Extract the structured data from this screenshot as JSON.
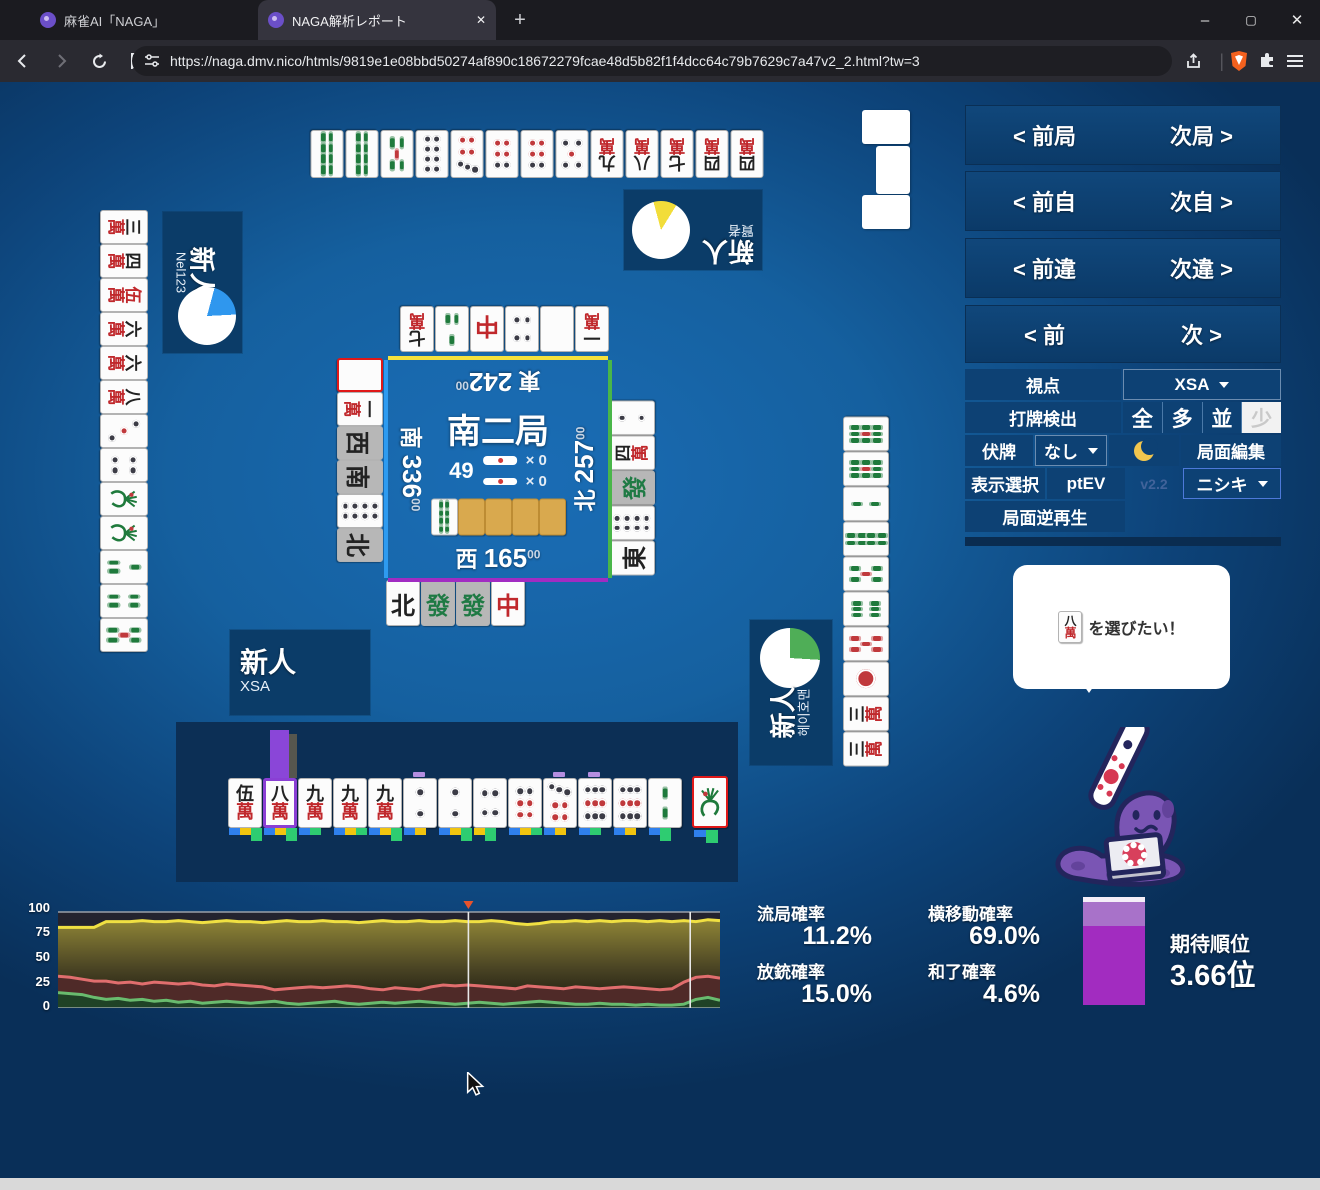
{
  "browser": {
    "tab1": "麻雀AI「NAGA」",
    "tab2": "NAGA解析レポート",
    "new_tab": "+",
    "close_tab": "✕",
    "minimize": "–",
    "maximize": "▢",
    "close_window": "✕",
    "url": "https://naga.dmv.nico/htmls/9819e1e08bbd50274af890c18672279fcae48d5b82f1f4dcc64c79b7629c7a47v2_2.html?tw=3"
  },
  "nav": {
    "rows": [
      {
        "prev": "< 前局",
        "next": "次局 >"
      },
      {
        "prev": "< 前自",
        "next": "次自 >"
      },
      {
        "prev": "< 前違",
        "next": "次違 >"
      },
      {
        "prev": "< 前",
        "next": "次 >"
      }
    ]
  },
  "controls": {
    "viewpoint_label": "視点",
    "viewpoint_value": "XSA",
    "dahai_label": "打牌検出",
    "dahai_options": [
      "全",
      "多",
      "並",
      "少"
    ],
    "dahai_selected": "少",
    "fusehai_label": "伏牌",
    "fusehai_value": "なし",
    "kyokumen_edit": "局面編集",
    "display_label": "表示選択",
    "display_value": "ptEV",
    "version": "v2.2",
    "model_value": "ニシキ",
    "replay": "局面逆再生"
  },
  "players": {
    "top": {
      "rank": "新人",
      "name": "賢者",
      "pie_color": "#f2dd3a",
      "pie_pct": 13
    },
    "left": {
      "rank": "新人",
      "name": "Nel123",
      "pie_color": "#2f97ee",
      "pie_pct": 20
    },
    "right": {
      "rank": "新人",
      "name": "헤이호맨",
      "pie_color": "#4fae57",
      "pie_pct": 26
    },
    "bottom": {
      "rank": "新人",
      "name": "XSA"
    }
  },
  "board": {
    "round": "南二局",
    "tiles_left": "49",
    "riichi_count": "× 0",
    "honba_count": "× 0",
    "score_suffix": "00",
    "scores": {
      "east": {
        "seat": "東",
        "value": "242"
      },
      "south": {
        "seat": "南",
        "value": "336"
      },
      "west": {
        "seat": "西",
        "value": "165"
      },
      "north": {
        "seat": "北",
        "value": "257"
      }
    }
  },
  "tiles": {
    "top_hand": [
      "8s",
      "8s",
      "5s",
      "8p",
      "7p",
      "6p",
      "6p",
      "5p",
      "9m",
      "8m",
      "7m",
      "4m",
      "4m"
    ],
    "left_hand": [
      "3m",
      "4m",
      "0m",
      "6m",
      "6m",
      "8m",
      "3p",
      "4p",
      "1s",
      "1s",
      "3s",
      "4s",
      "5s"
    ],
    "right_hand": [
      "9s",
      "9s",
      "2s",
      "8s",
      "5s",
      "6s",
      "0s",
      "1p",
      "3m",
      "3m"
    ],
    "discards_top": [
      "7m",
      "3s",
      "C",
      "4p",
      "P",
      "1m"
    ],
    "discards_left": [
      "P!",
      "1m",
      "W*",
      "S*",
      "8p",
      "N*"
    ],
    "discards_right": [
      "2p",
      "4m",
      "F*",
      "8p",
      "E"
    ],
    "discards_bottom": [
      "N",
      "F*",
      "F*",
      "C"
    ],
    "dora_indicator": "8s",
    "dora_facedown": 4,
    "bottom_hand": [
      {
        "t": "5m",
        "bars": [
          "b",
          "y",
          "G"
        ]
      },
      {
        "t": "8m",
        "sel": true,
        "bigbar": true,
        "bars": [
          "b",
          "y",
          "G"
        ]
      },
      {
        "t": "9m",
        "bars": [
          "b",
          "g"
        ]
      },
      {
        "t": "9m",
        "bars": [
          "b",
          "y",
          "g"
        ]
      },
      {
        "t": "9m",
        "bars": [
          "b",
          "y",
          "G"
        ]
      },
      {
        "t": "2p",
        "cap": true,
        "bars": [
          "b",
          "y"
        ]
      },
      {
        "t": "2p",
        "bars": [
          "b",
          "y",
          "G"
        ]
      },
      {
        "t": "4p",
        "bars": [
          "y",
          "G"
        ]
      },
      {
        "t": "6p",
        "bars": [
          "b",
          "y",
          "g"
        ]
      },
      {
        "t": "7p",
        "cap": true,
        "bars": [
          "b",
          "y"
        ]
      },
      {
        "t": "9p",
        "cap": true,
        "bars": [
          "b",
          "g"
        ]
      },
      {
        "t": "9p",
        "bars": [
          "b",
          "y"
        ]
      },
      {
        "t": "2s",
        "bars": [
          "b",
          "G"
        ]
      }
    ],
    "bottom_draw": {
      "t": "1s",
      "red": true,
      "bars": [
        "b",
        "G"
      ]
    }
  },
  "bubble": {
    "tile": "8m",
    "text": "を選びたい！"
  },
  "stats": {
    "items": [
      {
        "label": "流局確率",
        "value": "11.2%"
      },
      {
        "label": "放銃確率",
        "value": "15.0%"
      },
      {
        "label": "横移動確率",
        "value": "69.0%"
      },
      {
        "label": "和了確率",
        "value": "4.6%"
      }
    ],
    "rank_label": "期待順位",
    "rank_value": "3.66位"
  },
  "chart_data": {
    "type": "line",
    "ylim": [
      0,
      100
    ],
    "yticks": [
      "100",
      "75",
      "50",
      "25",
      "0"
    ],
    "grid": "top-line-only",
    "legend": "none",
    "series": [
      {
        "name": "yellow",
        "color": "#f0e042",
        "values": [
          84,
          84,
          84,
          84,
          90,
          90,
          90,
          91,
          90,
          90,
          91,
          90,
          89,
          90,
          91,
          90,
          90,
          89,
          90,
          91,
          90,
          90,
          91,
          90,
          90,
          89,
          90,
          91,
          90,
          90,
          91,
          90,
          90,
          91,
          90,
          90,
          91,
          90,
          88,
          87,
          88,
          90,
          90,
          91,
          90,
          91,
          90,
          91,
          91,
          90,
          91,
          90,
          91,
          90,
          92,
          91
        ]
      },
      {
        "name": "red",
        "color": "#e06e6e",
        "values": [
          33,
          32,
          30,
          28,
          28,
          26,
          27,
          25,
          27,
          26,
          25,
          26,
          24,
          23,
          25,
          24,
          23,
          22,
          19,
          20,
          21,
          22,
          21,
          22,
          23,
          22,
          20,
          19,
          21,
          20,
          19,
          22,
          24,
          23,
          24,
          23,
          22,
          21,
          20,
          23,
          22,
          21,
          20,
          22,
          21,
          20,
          21,
          22,
          21,
          20,
          19,
          20,
          27,
          32,
          33,
          31
        ]
      },
      {
        "name": "green",
        "color": "#69bb6e",
        "values": [
          16,
          15,
          14,
          11,
          9,
          10,
          8,
          9,
          7,
          8,
          6,
          7,
          5,
          6,
          7,
          6,
          5,
          6,
          7,
          5,
          4,
          5,
          6,
          7,
          5,
          4,
          5,
          6,
          5,
          6,
          7,
          6,
          5,
          4,
          5,
          6,
          5,
          4,
          5,
          6,
          7,
          6,
          5,
          4,
          4,
          5,
          4,
          4,
          3,
          4,
          3,
          3,
          4,
          9,
          11,
          8
        ]
      }
    ],
    "cursors_pct": [
      62,
      95.5
    ],
    "cursor_marker_color": "#e8532c"
  },
  "colors": {
    "accent_purple": "#8a46d8",
    "seat_top": "#f5e13c",
    "seat_left": "#2e9bf0",
    "seat_right": "#49b649",
    "seat_bottom": "#a12cc2",
    "gauge_main": "#a22cc0",
    "gauge_light": "#a872c9"
  }
}
